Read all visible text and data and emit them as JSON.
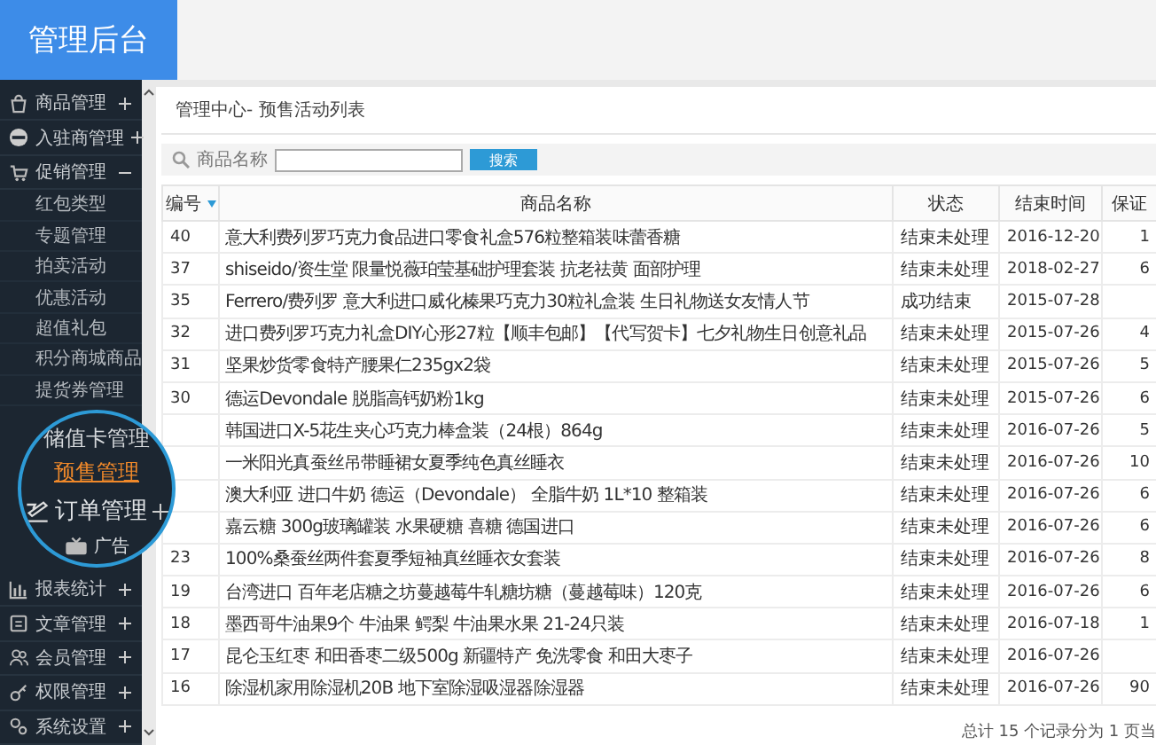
{
  "header": {
    "title": "管理后台"
  },
  "sidebar": {
    "items": [
      {
        "label": "商品管理",
        "expanded": false
      },
      {
        "label": "入驻商管理",
        "expanded": false
      },
      {
        "label": "促销管理",
        "expanded": true,
        "children": [
          {
            "label": "红包类型",
            "selected": false
          },
          {
            "label": "专题管理",
            "selected": false
          },
          {
            "label": "拍卖活动",
            "selected": false
          },
          {
            "label": "优惠活动",
            "selected": false
          },
          {
            "label": "超值礼包",
            "selected": false
          },
          {
            "label": "积分商城商品",
            "selected": false
          },
          {
            "label": "提货券管理",
            "selected": false
          }
        ]
      }
    ],
    "magnified_items": [
      {
        "kind": "sub",
        "label": "储值卡管理",
        "selected": false
      },
      {
        "kind": "sub",
        "label": "预售管理",
        "selected": true
      },
      {
        "kind": "menu",
        "label": "订单管理",
        "expanded": false
      },
      {
        "kind": "menu",
        "label": "广告"
      }
    ],
    "more_items": [
      {
        "label": "报表统计",
        "expanded": false
      },
      {
        "label": "文章管理",
        "expanded": false
      },
      {
        "label": "会员管理",
        "expanded": false
      },
      {
        "label": "权限管理",
        "expanded": false
      },
      {
        "label": "系统设置",
        "expanded": false
      }
    ]
  },
  "breadcrumb": "管理中心- 预售活动列表",
  "search": {
    "label": "商品名称",
    "button": "搜索"
  },
  "table": {
    "columns": [
      "编号",
      "商品名称",
      "状态",
      "结束时间",
      "保证"
    ],
    "rows": [
      {
        "id": "40",
        "name": "意大利费列罗巧克力食品进口零食礼盒576粒整箱装味蕾香糖",
        "status": "结束未处理",
        "end": "2016-12-20",
        "column_5": "1"
      },
      {
        "id": "37",
        "name": "shiseido/资生堂 限量悦薇珀莹基础护理套装 抗老祛黄 面部护理",
        "status": "结束未处理",
        "end": "2018-02-27",
        "column_5": "6"
      },
      {
        "id": "35",
        "name": "Ferrero/费列罗 意大利进口威化榛果巧克力30粒礼盒装 生日礼物送女友情人节",
        "status": "成功结束",
        "end": "2015-07-28"
      },
      {
        "id": "32",
        "name": "进口费列罗巧克力礼盒DIY心形27粒【顺丰包邮】【代写贺卡】七夕礼物生日创意礼品",
        "status": "结束未处理",
        "end": "2015-07-26",
        "column_5": "4"
      },
      {
        "id": "31",
        "name": "坚果炒货零食特产腰果仁235gx2袋",
        "status": "结束未处理",
        "end": "2015-07-26",
        "column_5": "5"
      },
      {
        "id": "30",
        "name": "德运Devondale 脱脂高钙奶粉1kg",
        "status": "结束未处理",
        "end": "2015-07-26",
        "column_5": "6"
      },
      {
        "name": "韩国进口X-5花生夹心巧克力棒盒装（24根）864g",
        "status": "结束未处理",
        "end": "2016-07-26",
        "column_5": "5"
      },
      {
        "name": "一米阳光真蚕丝吊带睡裙女夏季纯色真丝睡衣",
        "status": "结束未处理",
        "end": "2016-07-26",
        "column_5": "10"
      },
      {
        "name": "澳大利亚 进口牛奶 德运（Devondale） 全脂牛奶 1L*10 整箱装",
        "status": "结束未处理",
        "end": "2016-07-26",
        "column_5": "6"
      },
      {
        "name": "嘉云糖 300g玻璃罐装 水果硬糖 喜糖 德国进口",
        "status": "结束未处理",
        "end": "2016-07-26",
        "column_5": "6"
      },
      {
        "id": "23",
        "name": "100%桑蚕丝两件套夏季短袖真丝睡衣女套装",
        "status": "结束未处理",
        "end": "2016-07-26",
        "column_5": "8"
      },
      {
        "id": "19",
        "name": "台湾进口 百年老店糖之坊蔓越莓牛轧糖坊糖（蔓越莓味）120克",
        "status": "结束未处理",
        "end": "2016-07-26",
        "column_5": "6"
      },
      {
        "id": "18",
        "name": "墨西哥牛油果9个 牛油果 鳄梨 牛油果水果 21-24只装",
        "status": "结束未处理",
        "end": "2016-07-18",
        "column_5": "1"
      },
      {
        "id": "17",
        "name": "昆仑玉红枣 和田香枣二级500g 新疆特产 免洗零食 和田大枣子",
        "status": "结束未处理",
        "end": "2016-07-26"
      },
      {
        "id": "16",
        "name": "除湿机家用除湿机20B 地下室除湿吸湿器除湿器",
        "status": "结束未处理",
        "end": "2016-07-26",
        "column_5": "90"
      }
    ]
  },
  "footer": "总计 15 个记录分为 1 页当"
}
